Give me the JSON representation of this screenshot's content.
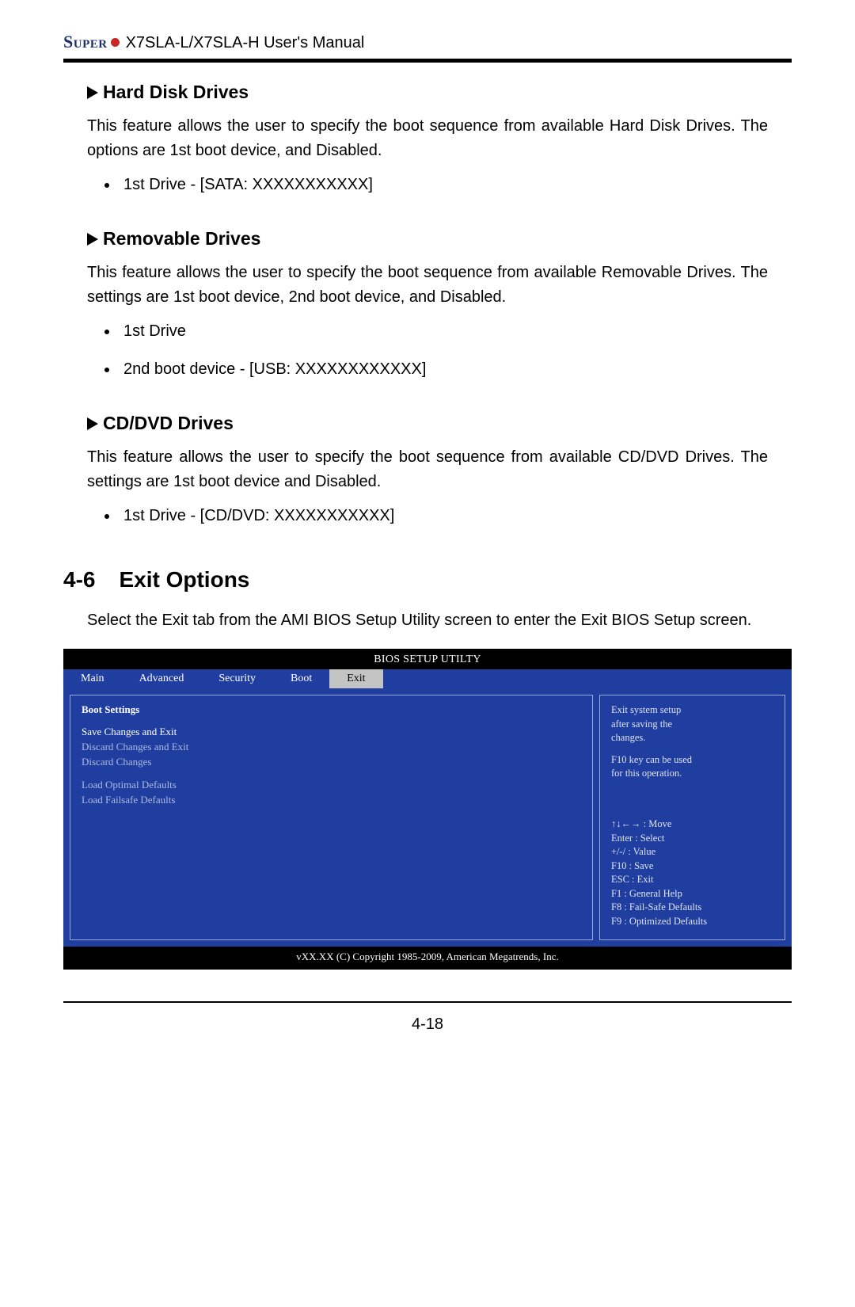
{
  "header": {
    "brand": "Super",
    "manual": "X7SLA-L/X7SLA-H User's Manual"
  },
  "sections": {
    "hdd": {
      "title": "Hard Disk Drives",
      "desc": "This feature allows the user to specify the boot sequence from available Hard Disk Drives. The options are 1st boot device, and Disabled.",
      "items": [
        "1st Drive - [SATA: XXXXXXXXXXX]"
      ]
    },
    "removable": {
      "title": "Removable Drives",
      "desc": "This feature allows the user to specify the boot sequence from available Removable Drives. The settings are 1st boot device, 2nd boot device, and Disabled.",
      "items": [
        "1st Drive",
        "2nd boot device - [USB: XXXXXXXXXXXX]"
      ]
    },
    "cddvd": {
      "title": "CD/DVD Drives",
      "desc": "This feature allows the user to specify the boot sequence from available CD/DVD Drives. The settings are 1st boot device and Disabled.",
      "items": [
        "1st Drive - [CD/DVD: XXXXXXXXXXX]"
      ]
    }
  },
  "exit": {
    "num": "4-6",
    "title": "Exit Options",
    "desc": "Select the Exit tab from the AMI BIOS Setup Utility screen to enter the Exit BIOS Setup screen."
  },
  "bios": {
    "title": "BIOS SETUP UTILTY",
    "tabs": [
      "Main",
      "Advanced",
      "Security",
      "Boot",
      "Exit"
    ],
    "active_tab": "Exit",
    "left_heading": "Boot Settings",
    "left_items": [
      "Save Changes and Exit",
      "Discard Changes and Exit",
      "Discard Changes",
      "",
      "Load Optimal Defaults",
      "Load Failsafe Defaults"
    ],
    "help_top": [
      "Exit system setup",
      "after saving the",
      "changes.",
      "",
      "F10 key can be used",
      "for this operation."
    ],
    "help_bottom": [
      "↑↓←→ : Move",
      "Enter : Select",
      "+/-/ : Value",
      "F10 : Save",
      "ESC : Exit",
      "F1 : General Help",
      "F8 : Fail-Safe Defaults",
      "F9 : Optimized Defaults"
    ],
    "footer": "vXX.XX (C) Copyright 1985-2009, American Megatrends, Inc."
  },
  "page_number": "4-18"
}
